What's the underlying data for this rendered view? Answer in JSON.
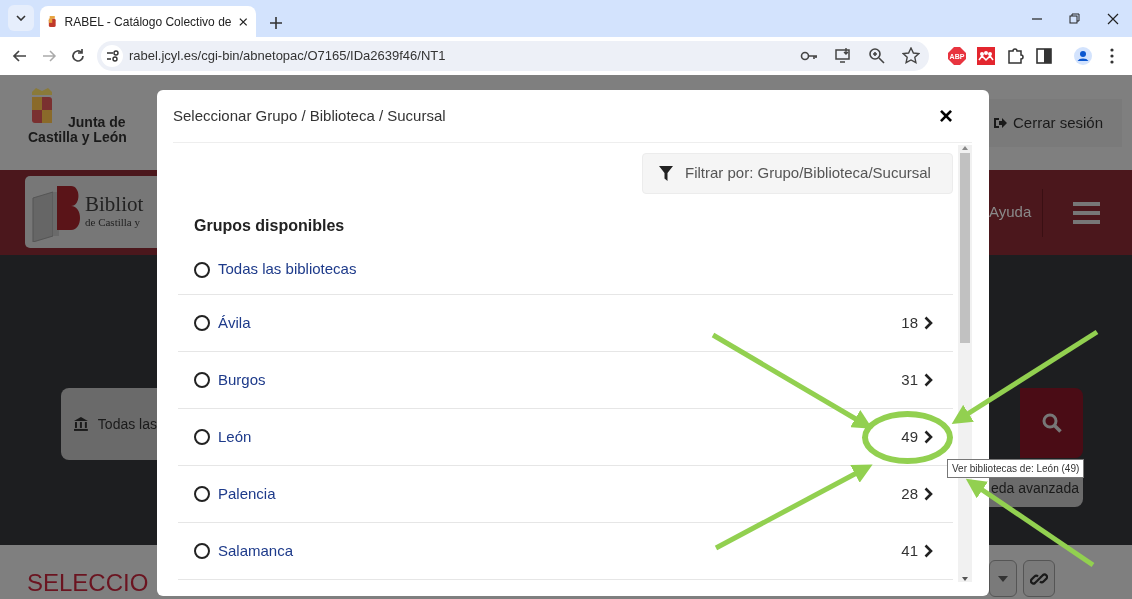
{
  "browser": {
    "tabs": [
      {
        "title": "RABEL - Catálogo Colectivo de",
        "selected": true
      }
    ],
    "url": "rabel.jcyl.es/cgi-bin/abnetopac/O7165/IDa2639f46/NT1",
    "extensions": [
      {
        "kind": "abp",
        "label": "ABP"
      }
    ]
  },
  "page": {
    "header": {
      "logo_lines": [
        "Junta de",
        "Castilla y León"
      ],
      "logout": "Cerrar sesión"
    },
    "band": {
      "logo_title": "Bibliot",
      "logo_subtitle": "de Castilla y",
      "help": "Ayuda"
    },
    "search": {
      "scope": "Todas las",
      "advanced": "eda avanzada"
    },
    "section_title": "SELECCIO"
  },
  "modal": {
    "title": "Seleccionar Grupo / Biblioteca / Sucursal",
    "close": "×",
    "filter": "Filtrar por: Grupo/Biblioteca/Sucursal",
    "heading": "Grupos disponibles",
    "groups": [
      {
        "name": "Todas las bibliotecas",
        "selected": false,
        "highlighted": false
      },
      {
        "name": "Ávila",
        "count": "18",
        "selected": false,
        "highlighted": false
      },
      {
        "name": "Burgos",
        "count": "31",
        "selected": false,
        "highlighted": false
      },
      {
        "name": "León",
        "count": "49",
        "selected": false,
        "highlighted": true
      },
      {
        "name": "Palencia",
        "count": "28",
        "selected": false,
        "highlighted": false
      },
      {
        "name": "Salamanca",
        "count": "41",
        "selected": false,
        "highlighted": false
      }
    ]
  },
  "tooltip": "Ver bibliotecas de: León (49)"
}
